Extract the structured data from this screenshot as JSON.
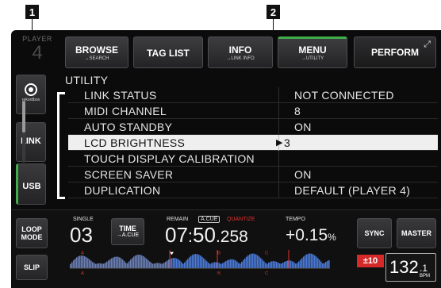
{
  "callouts": [
    "1",
    "2"
  ],
  "player": {
    "label": "PLAYER",
    "number": "4"
  },
  "nav": {
    "browse": {
      "label": "BROWSE",
      "sub": "→SEARCH"
    },
    "taglist": {
      "label": "TAG LIST"
    },
    "info": {
      "label": "INFO",
      "sub": "→LINK INFO"
    },
    "menu": {
      "label": "MENU",
      "sub": "→UTILITY"
    },
    "perform": {
      "label": "PERFORM"
    }
  },
  "sources": {
    "rekordbox": "rekordbox",
    "link": "LINK",
    "usb": "USB"
  },
  "list": {
    "title": "UTILITY",
    "rows": [
      {
        "label": "LINK STATUS",
        "value": "NOT CONNECTED"
      },
      {
        "label": "MIDI CHANNEL",
        "value": "8"
      },
      {
        "label": "AUTO STANDBY",
        "value": "ON"
      },
      {
        "label": "LCD BRIGHTNESS",
        "value": "3"
      },
      {
        "label": "TOUCH DISPLAY CALIBRATION",
        "value": ""
      },
      {
        "label": "SCREEN SAVER",
        "value": "ON"
      },
      {
        "label": "DUPLICATION",
        "value": "DEFAULT (PLAYER 4)"
      }
    ],
    "selected_index": 3
  },
  "deck": {
    "loop_mode": "LOOP\nMODE",
    "slip": "SLIP",
    "single_label": "SINGLE",
    "track_number": "03",
    "time_button": "TIME",
    "time_sub": "→A.CUE",
    "remain_label": "REMAIN",
    "acue_label": "A.CUE",
    "quantize_label": "QUANTIZE",
    "time_display": {
      "minutes": "07",
      "seconds": "50",
      "ms": ".258"
    },
    "tempo_label": "TEMPO",
    "tempo_value": "+0.15",
    "tempo_unit": "%",
    "sync": "SYNC",
    "master": "MASTER",
    "tempo_range": "±10",
    "bpm": "132",
    "bpm_decimal": ".1",
    "bpm_label": "BPM",
    "markers": [
      "A",
      "B",
      "C",
      "A",
      "B",
      "C"
    ]
  },
  "colors": {
    "accent_green": "#3fae4a",
    "quantize_red": "#e0322b",
    "tempo_range_bg": "#d62a2a",
    "waveform_blue": "#4a7ad8",
    "selected_row_bg": "#efefef"
  }
}
